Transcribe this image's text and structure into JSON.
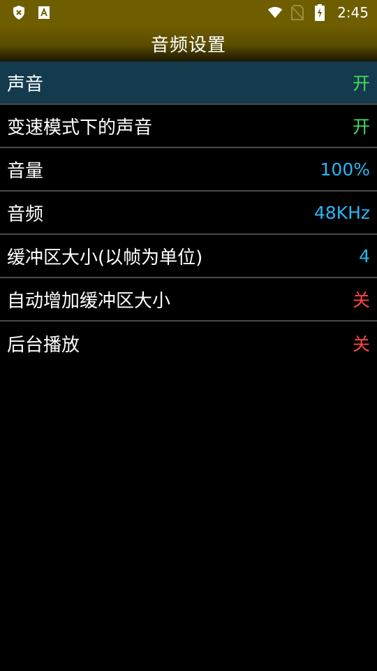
{
  "status_bar": {
    "time": "2:45",
    "icons": [
      "shield-x-icon",
      "font-a-icon",
      "wifi-icon",
      "no-sim-icon",
      "battery-charging-icon"
    ]
  },
  "header": {
    "title": "音频设置"
  },
  "colors": {
    "status_bar_bg": "#6e5e00",
    "selected_row_bg": "#133a4d",
    "on_color": "#44dd55",
    "value_color": "#29b6f6",
    "off_color": "#ff4444"
  },
  "settings": [
    {
      "label": "声音",
      "value": "开",
      "selected": true
    },
    {
      "label": "变速模式下的声音",
      "value": "开"
    },
    {
      "label": "音量",
      "value": "100%"
    },
    {
      "label": "音频",
      "value": "48KHz"
    },
    {
      "label": "缓冲区大小(以帧为单位)",
      "value": "4"
    },
    {
      "label": "自动增加缓冲区大小",
      "value": "关"
    },
    {
      "label": "后台播放",
      "value": "关"
    }
  ]
}
